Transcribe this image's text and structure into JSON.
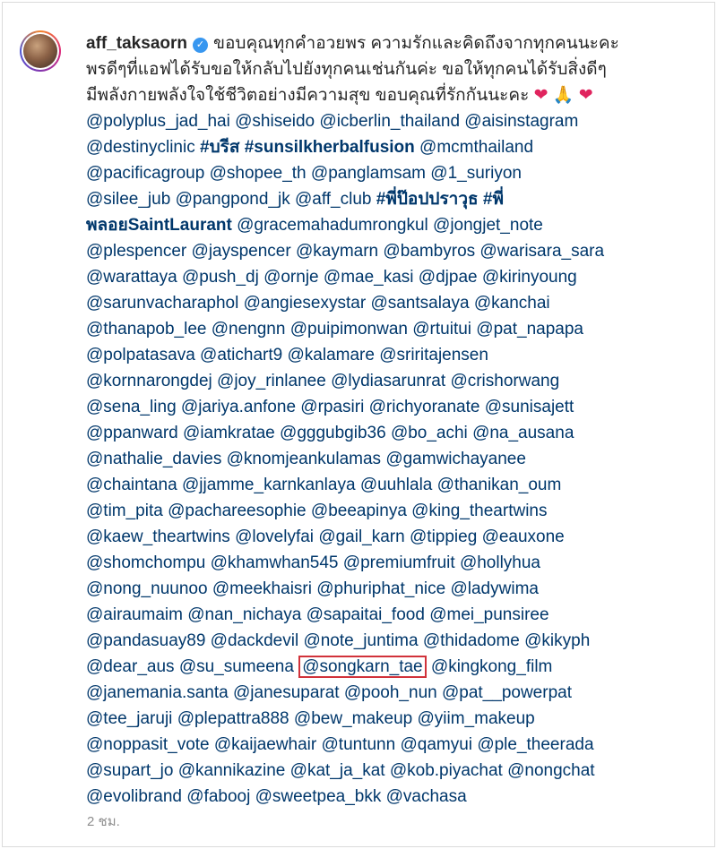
{
  "post": {
    "username": "aff_taksaorn",
    "verified_icon": "verified-badge-icon",
    "time": "2 ชม.",
    "caption": {
      "line1_text": "ขอบคุณทุกคำอวยพร ความรักและคิดถึงจากทุกคนนะคะ",
      "line2_text": "พรดีๆที่แอฟได้รับขอให้กลับไปยังทุกคนเช่นกันค่ะ ขอให้ทุกคนได้รับสิ่งดีๆ",
      "line3_text": "มีพลังกายพลังใจใช้ชีวิตอย่างมีความสุข ขอบคุณที่รักกันนะคะ",
      "line3_emoji": [
        "❤",
        "🙏",
        "❤"
      ],
      "line4": [
        "@polyplus_jad_hai",
        "@shiseido",
        "@icberlin_thailand",
        "@aisinstagram"
      ],
      "line5_mention1": "@destinyclinic",
      "line5_tag1": "#บรีส",
      "line5_tag2": "#sunsilkherbalfusion",
      "line5_mention2": "@mcmthailand",
      "line6": [
        "@pacificagroup",
        "@shopee_th",
        "@panglamsam",
        "@1_suriyon"
      ],
      "line7_mentions": [
        "@silee_jub",
        "@pangpond_jk",
        "@aff_club"
      ],
      "line7_tag1": "#พี่ป๊อปปราวุธ",
      "line7_tag2": "#พี่",
      "line8_tag": "พลอย",
      "line8_mentions": [
        "SaintLaurant",
        "@gracemahadumrongkul",
        "@jongjet_note"
      ],
      "line9": [
        "@plespencer",
        "@jayspencer",
        "@kaymarn",
        "@bambyros",
        "@warisara_sara"
      ],
      "line10": [
        "@warattaya",
        "@push_dj",
        "@ornje",
        "@mae_kasi",
        "@djpae",
        "@kirinyoung"
      ],
      "line11": [
        "@sarunvacharaphol",
        "@angiesexystar",
        "@santsalaya",
        "@kanchai"
      ],
      "line12": [
        "@thanapob_lee",
        "@nengnn",
        "@puipimonwan",
        "@rtuitui",
        "@pat_napapa"
      ],
      "line13": [
        "@polpatasava",
        "@atichart9",
        "@kalamare",
        "@sriritajensen"
      ],
      "line14": [
        "@kornnarongdej",
        "@joy_rinlanee",
        "@lydiasarunrat",
        "@crishorwang"
      ],
      "line15": [
        "@sena_ling",
        "@jariya.anfone",
        "@rpasiri",
        "@richyoranate",
        "@sunisajett"
      ],
      "line16": [
        "@ppanward",
        "@iamkratae",
        "@gggubgib36",
        "@bo_achi",
        "@na_ausana"
      ],
      "line17": [
        "@nathalie_davies",
        "@knomjeankulamas",
        "@gamwichayanee"
      ],
      "line18": [
        "@chaintana",
        "@jjamme_karnkanlaya",
        "@uuhlala",
        "@thanikan_oum"
      ],
      "line19": [
        "@tim_pita",
        "@pachareesophie",
        "@beeapinya",
        "@king_theartwins"
      ],
      "line20": [
        "@kaew_theartwins",
        "@lovelyfai",
        "@gail_karn",
        "@tippieg",
        "@eauxone"
      ],
      "line21": [
        "@shomchompu",
        "@khamwhan545",
        "@premiumfruit",
        "@hollyhua"
      ],
      "line22": [
        "@nong_nuunoo",
        "@meekhaisri",
        "@phuriphat_nice",
        "@ladywima"
      ],
      "line23": [
        "@airaumaim",
        "@nan_nichaya",
        "@sapaitai_food",
        "@mei_punsiree"
      ],
      "line24": [
        "@pandasuay89",
        "@dackdevil",
        "@note_juntima",
        "@thidadome",
        "@kikyph"
      ],
      "line25_before": [
        "@dear_aus",
        "@su_sumeena"
      ],
      "line25_highlight": "@songkarn_tae",
      "line25_after": "@kingkong_film",
      "line26": [
        "@janemania.santa",
        "@janesuparat",
        "@pooh_nun",
        "@pat__powerpat"
      ],
      "line27": [
        "@tee_jaruji",
        "@plepattra888",
        "@bew_makeup",
        "@yiim_makeup"
      ],
      "line28": [
        "@noppasit_vote",
        "@kaijaewhair",
        "@tuntunn",
        "@qamyui",
        "@ple_theerada"
      ],
      "line29": [
        "@supart_jo",
        "@kannikazine",
        "@kat_ja_kat",
        "@kob.piyachat",
        "@nongchat"
      ],
      "line30": [
        "@evolibrand",
        "@fabooj",
        "@sweetpea_bkk",
        "@vachasa"
      ]
    },
    "colors": {
      "mention": "#00376b",
      "text": "#262626",
      "highlight_box": "#d1323a",
      "time": "#8e8e8e"
    }
  }
}
